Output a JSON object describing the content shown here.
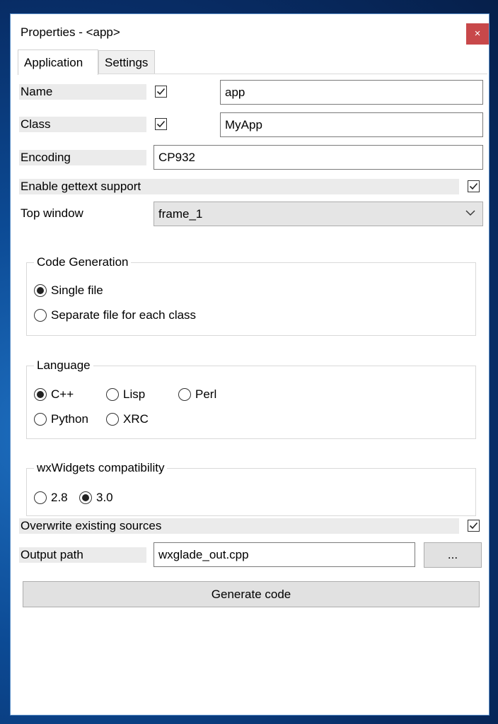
{
  "window": {
    "title": "Properties - <app>",
    "close_symbol": "×"
  },
  "tabs": [
    {
      "label": "Application",
      "active": true
    },
    {
      "label": "Settings",
      "active": false
    }
  ],
  "fields": {
    "name": {
      "label": "Name",
      "checked": true,
      "value": "app"
    },
    "class": {
      "label": "Class",
      "checked": true,
      "value": "MyApp"
    },
    "encoding": {
      "label": "Encoding",
      "value": "CP932"
    },
    "gettext": {
      "label": "Enable gettext support",
      "checked": true
    },
    "top_window": {
      "label": "Top window",
      "value": "frame_1"
    },
    "overwrite": {
      "label": "Overwrite existing sources",
      "checked": true
    },
    "output_path": {
      "label": "Output path",
      "value": "wxglade_out.cpp",
      "browse_label": "..."
    }
  },
  "code_generation": {
    "title": "Code Generation",
    "options": [
      {
        "label": "Single file",
        "selected": true
      },
      {
        "label": "Separate file for each class",
        "selected": false
      }
    ]
  },
  "language": {
    "title": "Language",
    "options": [
      {
        "label": "C++",
        "selected": true
      },
      {
        "label": "Lisp",
        "selected": false
      },
      {
        "label": "Perl",
        "selected": false
      },
      {
        "label": "Python",
        "selected": false
      },
      {
        "label": "XRC",
        "selected": false
      }
    ]
  },
  "compat": {
    "title": "wxWidgets compatibility",
    "options": [
      {
        "label": "2.8",
        "selected": false
      },
      {
        "label": "3.0",
        "selected": true
      }
    ]
  },
  "generate_label": "Generate code",
  "colors": {
    "close": "#c8484a",
    "label_bg": "#ebebeb",
    "button_bg": "#e1e1e1"
  }
}
